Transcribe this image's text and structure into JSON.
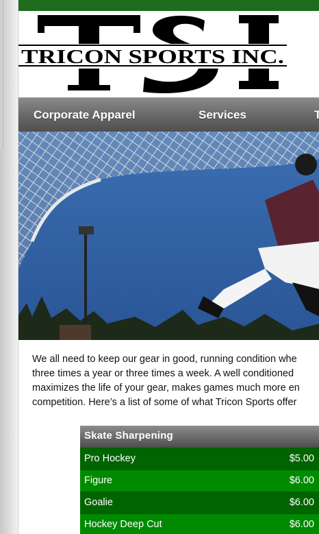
{
  "brand": {
    "logo_letters": "TSI",
    "company_name": "TRICON SPORTS INC."
  },
  "nav": {
    "items": [
      {
        "label": "Corporate Apparel"
      },
      {
        "label": "Services"
      },
      {
        "label": "T"
      }
    ]
  },
  "intro": {
    "lines": [
      "We all need to keep our gear in good, running condition whe",
      "three times a year or three times a week. A well conditioned",
      "maximizes the life of your gear, makes games much more en",
      "competition. Here’s a list of some of what Tricon Sports offer"
    ]
  },
  "pricing": {
    "title": "Skate Sharpening",
    "rows": [
      {
        "service": "Pro Hockey",
        "price": "$5.00"
      },
      {
        "service": "Figure",
        "price": "$6.00"
      },
      {
        "service": "Goalie",
        "price": "$6.00"
      },
      {
        "service": "Hockey Deep Cut",
        "price": "$6.00"
      }
    ]
  },
  "colors": {
    "topbar": "#1f6b1f",
    "row_dark": "#006400",
    "row_light": "#008a00",
    "sky": "#2f5fa0"
  }
}
